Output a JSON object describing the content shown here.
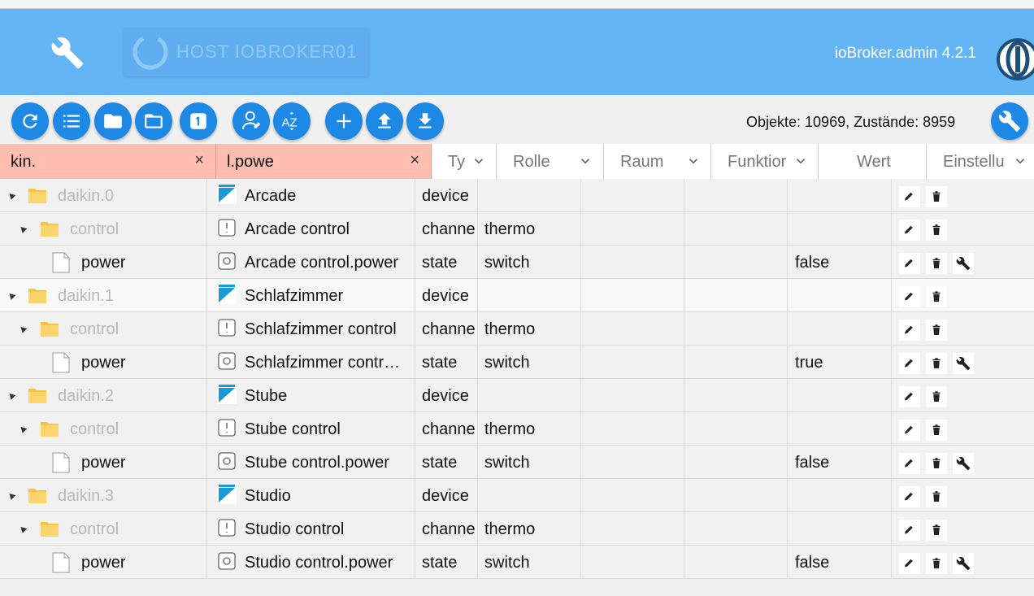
{
  "appbar": {
    "host_label": "HOST IOBROKER01",
    "admin_version": "ioBroker.admin 4.2.1",
    "icons": [
      "wrench-icon",
      "power-icon",
      "iobroker-logo"
    ]
  },
  "toolbar": {
    "buttons": [
      "refresh-icon",
      "list-icon",
      "folder-filled-icon",
      "folder-outline-icon",
      "counter-one-icon",
      "expert-user-icon",
      "sort-az-icon",
      "add-icon",
      "upload-icon",
      "download-icon"
    ],
    "counts": "Objekte: 10969, Zustände: 8959"
  },
  "filters": {
    "id_filter": "kin.",
    "name_filter": "l.powe",
    "clear_symbol": "×"
  },
  "columns": {
    "type": "Ty",
    "role": "Rolle",
    "room": "Raum",
    "function": "Funktior",
    "value": "Wert",
    "settings": "Einstellu"
  },
  "rows": [
    {
      "id": "daikin.0",
      "name": "Arcade",
      "type": "device",
      "role": "",
      "value": ""
    },
    {
      "id": "control",
      "name": "Arcade control",
      "type": "channe",
      "role": "thermo",
      "value": ""
    },
    {
      "id": "power",
      "name": "Arcade control.power",
      "type": "state",
      "role": "switch",
      "value": "false"
    },
    {
      "id": "daikin.1",
      "name": "Schlafzimmer",
      "type": "device",
      "role": "",
      "value": ""
    },
    {
      "id": "control",
      "name": "Schlafzimmer control",
      "type": "channe",
      "role": "thermo",
      "value": ""
    },
    {
      "id": "power",
      "name": "Schlafzimmer contr…",
      "type": "state",
      "role": "switch",
      "value": "true"
    },
    {
      "id": "daikin.2",
      "name": "Stube",
      "type": "device",
      "role": "",
      "value": ""
    },
    {
      "id": "control",
      "name": "Stube control",
      "type": "channe",
      "role": "thermo",
      "value": ""
    },
    {
      "id": "power",
      "name": "Stube control.power",
      "type": "state",
      "role": "switch",
      "value": "false"
    },
    {
      "id": "daikin.3",
      "name": "Studio",
      "type": "device",
      "role": "",
      "value": ""
    },
    {
      "id": "control",
      "name": "Studio control",
      "type": "channe",
      "role": "thermo",
      "value": ""
    },
    {
      "id": "power",
      "name": "Studio control.power",
      "type": "state",
      "role": "switch",
      "value": "false"
    }
  ],
  "colors": {
    "appbar": "#64b5f6",
    "button": "#1e88e5",
    "filter_bg": "#ffbdb0"
  }
}
